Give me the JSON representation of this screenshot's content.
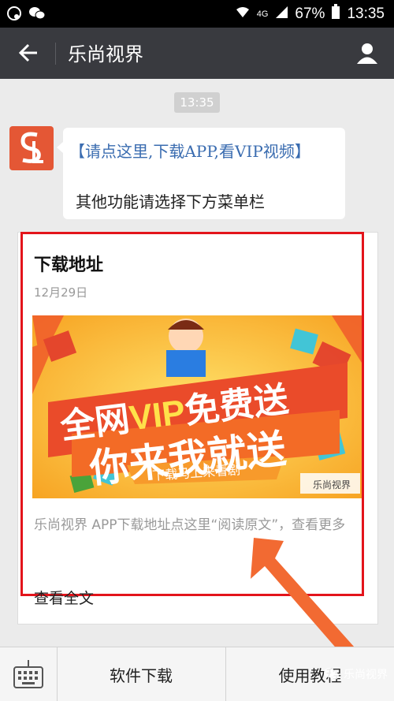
{
  "status_bar": {
    "network": "4G",
    "battery": "67%",
    "time": "13:35"
  },
  "app_bar": {
    "title": "乐尚视界"
  },
  "chat": {
    "timestamp": "13:35",
    "bot_message": {
      "line1": "【请点这里,下载APP,看VIP视频】",
      "line2": "其他功能请选择下方菜单栏"
    },
    "article_card": {
      "title": "下载地址",
      "date": "12月29日",
      "banner": {
        "headline_prefix": "全网",
        "headline_vip": "VIP",
        "headline_suffix": "免费送",
        "subhead": "你来我就送",
        "tagline": "下载马上来看剧",
        "watermark": "乐尚视界"
      },
      "description": "乐尚视界 APP下载地址点这里“阅读原文”，查看更多",
      "read_more": "查看全文"
    }
  },
  "bottom_menu": {
    "items": [
      "软件下载",
      "使用教程"
    ]
  },
  "watermark": "乐尚视界",
  "colors": {
    "accent_red": "#e3141b",
    "link_blue": "#3a6cb0",
    "app_bar": "#393a3f",
    "arrow_orange": "#f26a32"
  }
}
